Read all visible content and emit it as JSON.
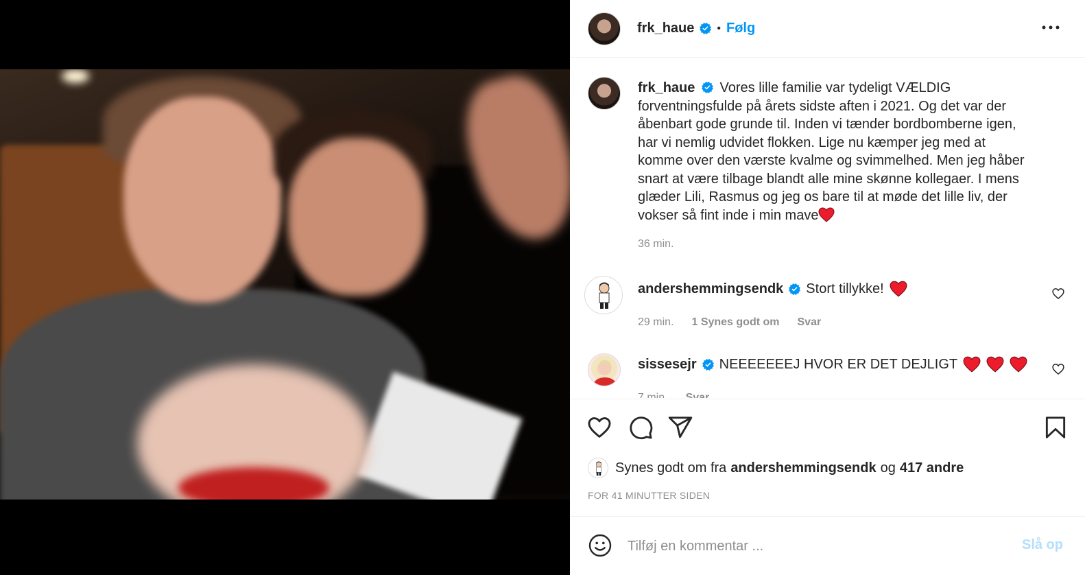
{
  "post": {
    "author": "frk_haue",
    "follow_label": "Følg",
    "separator": "•"
  },
  "caption": {
    "username": "frk_haue",
    "lines": [
      "Vores lille familie var tydeligt VÆLDIG",
      "forventningsfulde på årets sidste aften i 2021. Og det var der",
      "åbenbart gode grunde til. Inden vi tænder bordbomberne igen,",
      "har vi nemlig udvidet flokken. Lige nu kæmper jeg med at",
      "komme over den værste kvalme og svimmelhed. Men jeg håber",
      "snart at være tilbage blandt alle mine skønne kollegaer. I mens",
      "glæder Lili, Rasmus og jeg os bare til at møde det lille liv, der",
      "vokser så fint inde i min mave"
    ],
    "time": "36 min."
  },
  "comments": [
    {
      "username": "andershemmingsendk",
      "text": "Stort tillykke!",
      "hearts": 1,
      "time": "29 min.",
      "likes": "1 Synes godt om",
      "reply": "Svar"
    },
    {
      "username": "sissesejr",
      "text": "NEEEEEEEJ HVOR ER DET DEJLIGT",
      "hearts": 3,
      "time": "7 min.",
      "reply": "Svar"
    }
  ],
  "likes_line": {
    "prefix": "Synes godt om fra",
    "user": "andershemmingsendk",
    "conj": "og",
    "others": "417 andre"
  },
  "time_ago": "FOR 41 MINUTTER SIDEN",
  "comment_box": {
    "placeholder": "Tilføj en kommentar ...",
    "post_label": "Slå op"
  },
  "colors": {
    "accent": "#0095f6",
    "heart": "#ed1c2c",
    "muted": "#8e8e8e",
    "post_disabled": "#b2dffc"
  },
  "icons": [
    "heart-icon",
    "comment-icon",
    "share-icon",
    "bookmark-icon",
    "emoji-icon",
    "more-icon",
    "verified-icon"
  ]
}
